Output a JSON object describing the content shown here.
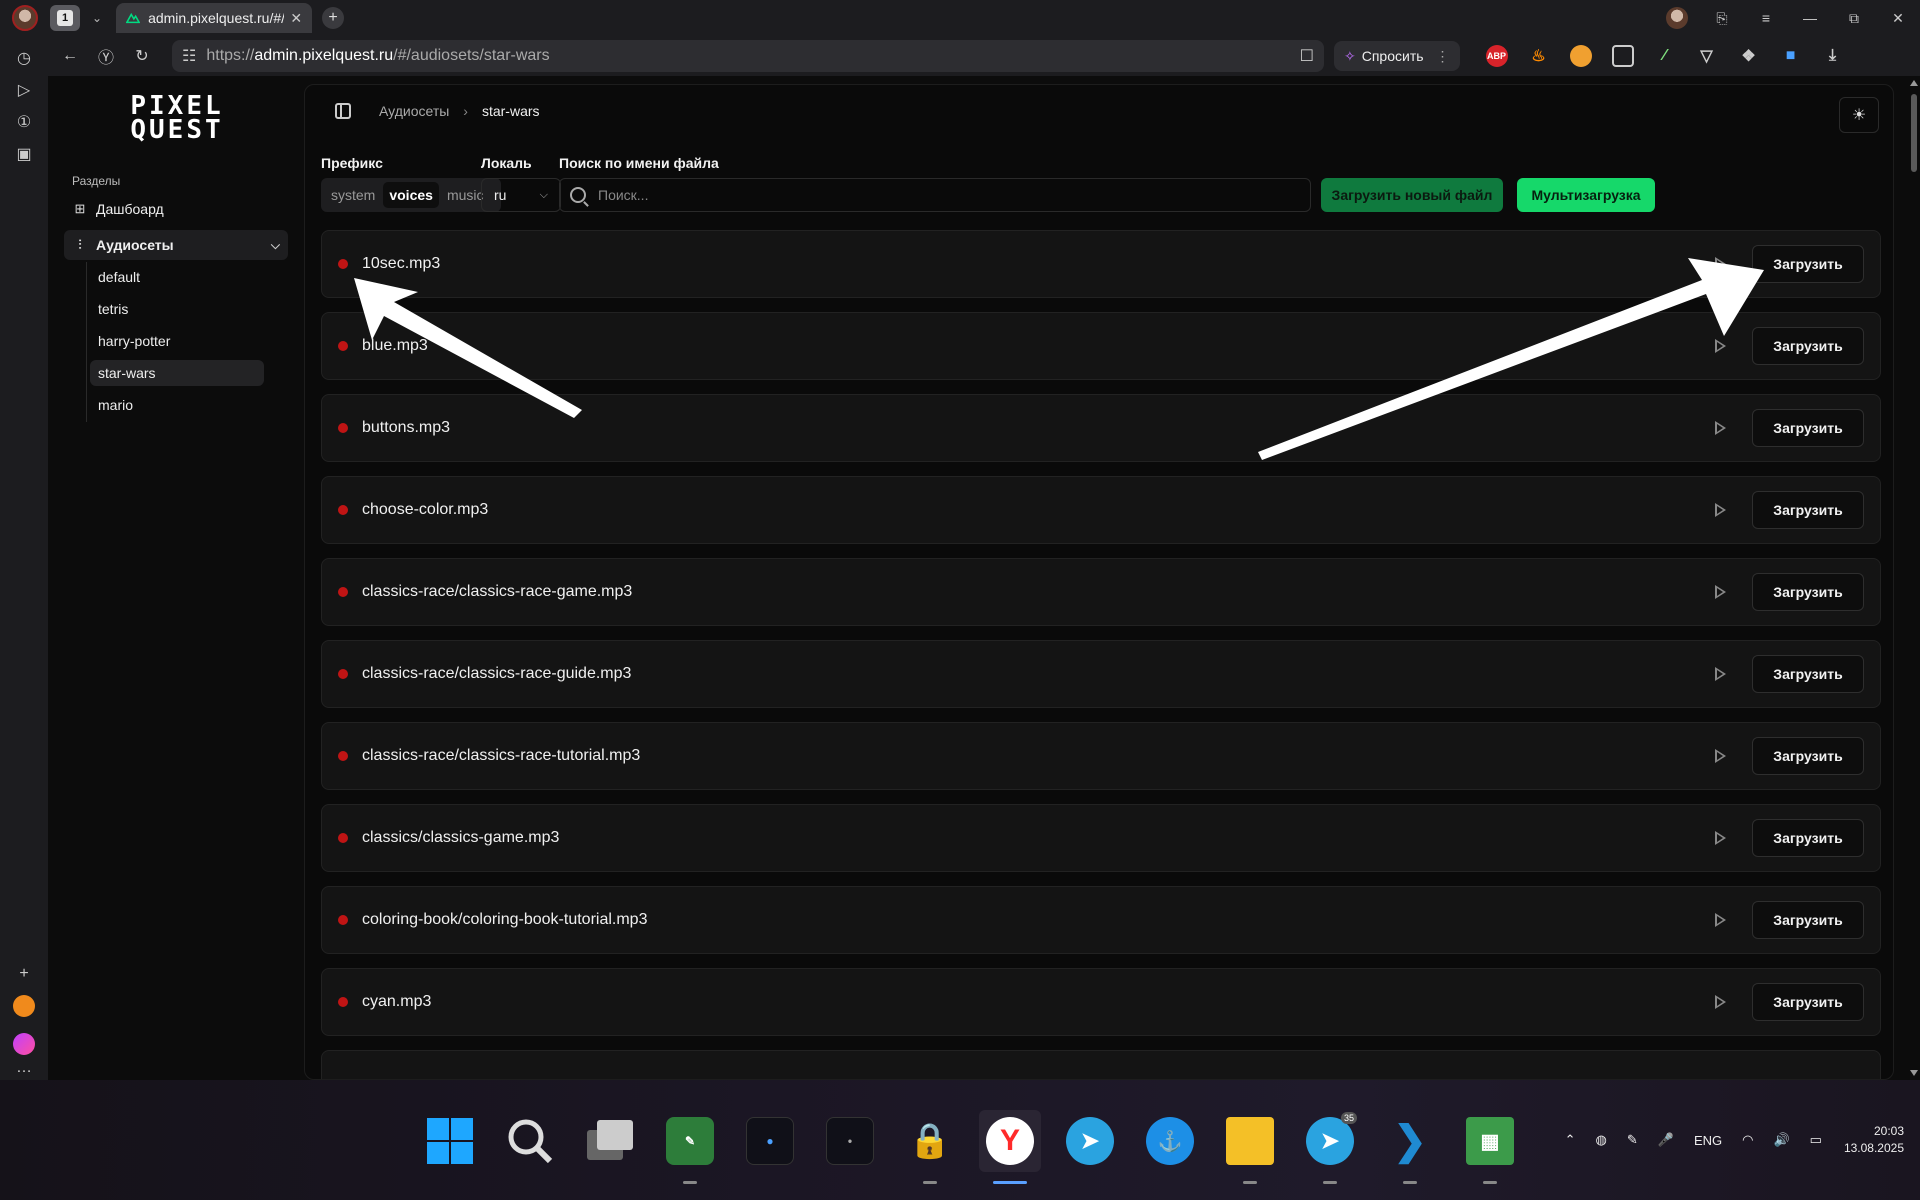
{
  "browser": {
    "tab_count": "1",
    "tab_title": "admin.pixelquest.ru/#/a",
    "url_prefix": "https://",
    "url_host": "admin.pixelquest.ru",
    "url_path": "/#/audiosets/star-wars",
    "ask_label": "Спросить",
    "accent_color": "#c01414"
  },
  "app": {
    "logo_line1": "PIXEL",
    "logo_line2": "QUEST",
    "sections_title": "Разделы",
    "nav": {
      "dashboard": "Дашбоард",
      "audiosets": "Аудиосеты"
    },
    "audiosets": [
      "default",
      "tetris",
      "harry-potter",
      "star-wars",
      "mario"
    ],
    "selected_audioset": "star-wars"
  },
  "breadcrumb": {
    "root": "Аудиосеты",
    "current": "star-wars"
  },
  "filters": {
    "prefix_label": "Префикс",
    "prefix_options": [
      "system",
      "voices",
      "music"
    ],
    "prefix_selected": "voices",
    "locale_label": "Локаль",
    "locale_value": "ru",
    "search_label": "Поиск по имени файла",
    "search_placeholder": "Поиск...",
    "upload_new_label": "Загрузить новый файл",
    "multi_upload_label": "Мультизагрузка"
  },
  "files": [
    "10sec.mp3",
    "blue.mp3",
    "buttons.mp3",
    "choose-color.mp3",
    "classics-race/classics-race-game.mp3",
    "classics-race/classics-race-guide.mp3",
    "classics-race/classics-race-tutorial.mp3",
    "classics/classics-game.mp3",
    "coloring-book/coloring-book-tutorial.mp3",
    "cyan.mp3"
  ],
  "upload_label": "Загрузить",
  "taskbar": {
    "lang": "ENG",
    "time": "20:03",
    "date": "13.08.2025",
    "telegram_badge": "35"
  }
}
